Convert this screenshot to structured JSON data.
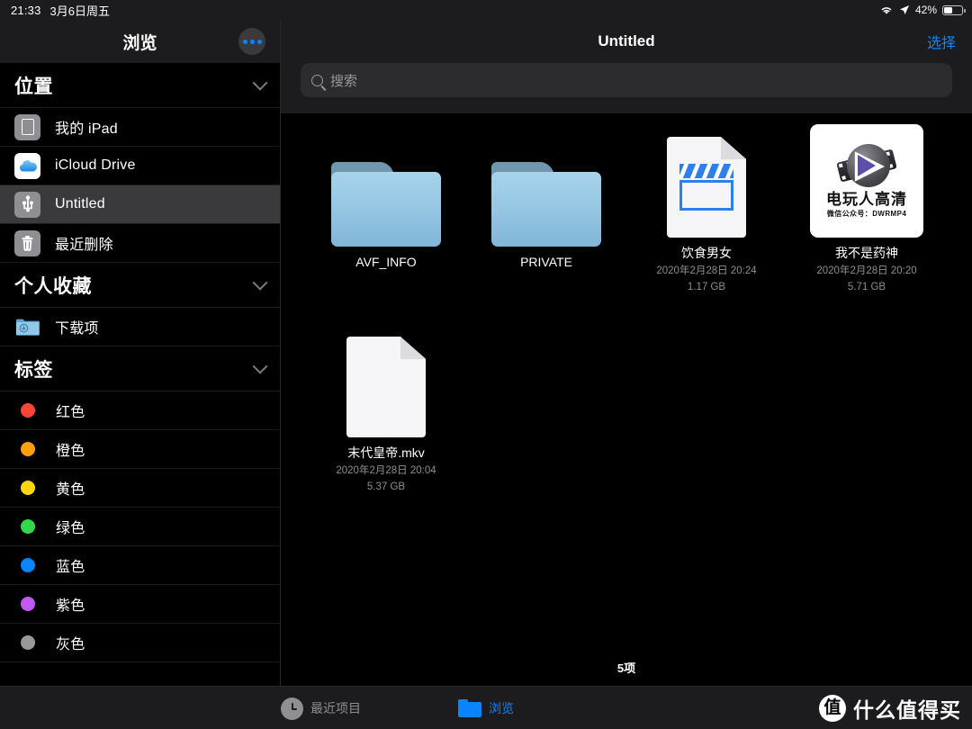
{
  "status_bar": {
    "time": "21:33",
    "date": "3月6日周五",
    "wifi_icon": "wifi-icon",
    "location_icon": "location-arrow-icon",
    "battery_percent": "42%",
    "battery_level": 42
  },
  "sidebar": {
    "title": "浏览",
    "more_button": "more-options-button",
    "sections": [
      {
        "title": "位置",
        "collapsed": false,
        "items": [
          {
            "label": "我的 iPad",
            "icon": "ipad-icon",
            "selected": false
          },
          {
            "label": "iCloud Drive",
            "icon": "icloud-icon",
            "selected": false
          },
          {
            "label": "Untitled",
            "icon": "usb-drive-icon",
            "selected": true
          },
          {
            "label": "最近删除",
            "icon": "trash-icon",
            "selected": false
          }
        ]
      },
      {
        "title": "个人收藏",
        "collapsed": false,
        "items": [
          {
            "label": "下载项",
            "icon": "downloads-folder-icon",
            "selected": false
          }
        ]
      },
      {
        "title": "标签",
        "collapsed": false,
        "tags": [
          {
            "label": "红色",
            "color": "#ff453a"
          },
          {
            "label": "橙色",
            "color": "#ff9f0a"
          },
          {
            "label": "黄色",
            "color": "#ffd60a"
          },
          {
            "label": "绿色",
            "color": "#32d74b"
          },
          {
            "label": "蓝色",
            "color": "#0a84ff"
          },
          {
            "label": "紫色",
            "color": "#bf5af2"
          },
          {
            "label": "灰色",
            "color": "#98989d"
          }
        ]
      }
    ]
  },
  "main": {
    "title": "Untitled",
    "select_button": "选择",
    "search": {
      "placeholder": "搜索",
      "value": "",
      "icon": "search-icon"
    },
    "items": [
      {
        "name": "AVF_INFO",
        "kind": "folder",
        "date": "",
        "size": ""
      },
      {
        "name": "PRIVATE",
        "kind": "folder",
        "date": "",
        "size": ""
      },
      {
        "name": "饮食男女",
        "kind": "movie-document",
        "date": "2020年2月28日 20:24",
        "size": "1.17 GB"
      },
      {
        "name": "我不是药神",
        "kind": "movie-thumbnail",
        "date": "2020年2月28日 20:20",
        "size": "5.71 GB",
        "thumbnail_text_main": "电玩人高清",
        "thumbnail_text_sub": "微信公众号：DWRMP4"
      },
      {
        "name": "末代皇帝.mkv",
        "kind": "blank-document",
        "date": "2020年2月28日 20:04",
        "size": "5.37 GB"
      }
    ],
    "item_count": "5项"
  },
  "tabbar": {
    "tabs": [
      {
        "label": "最近项目",
        "icon": "clock-icon",
        "active": false
      },
      {
        "label": "浏览",
        "icon": "folder-icon",
        "active": true
      }
    ]
  },
  "watermark": {
    "logo_char": "值",
    "text": "什么值得买"
  },
  "colors": {
    "accent": "#0a84ff",
    "background": "#000000",
    "chrome": "#1c1c1e",
    "selected_row": "#3a3a3c",
    "secondary_text": "#8e8e93"
  }
}
